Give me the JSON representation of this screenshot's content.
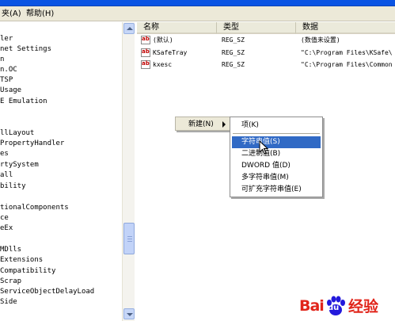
{
  "menubar": {
    "items": [
      "夹(A)",
      "帮助(H)"
    ]
  },
  "tree": {
    "items": [
      "ler",
      "net Settings",
      "n",
      "n.OC",
      "TSP",
      "Usage",
      "E Emulation",
      "",
      "",
      "llLayout",
      "PropertyHandler",
      "es",
      "rtySystem",
      "all",
      "bility",
      "",
      "tionalComponents",
      "ce",
      "eEx",
      "",
      "MDlls",
      "Extensions",
      "Compatibility",
      "Scrap",
      "ServiceObjectDelayLoad",
      "Side"
    ]
  },
  "list": {
    "headers": {
      "name": "名称",
      "type": "类型",
      "data": "数据"
    },
    "rows": [
      {
        "name": "(默认)",
        "type": "REG_SZ",
        "data": "(数值未设置)"
      },
      {
        "name": "KSafeTray",
        "type": "REG_SZ",
        "data": "\"C:\\Program Files\\KSafe\\"
      },
      {
        "name": "kxesc",
        "type": "REG_SZ",
        "data": "\"C:\\Program Files\\Common"
      }
    ],
    "icon_text": "ab"
  },
  "context_menu": {
    "new_label": "新建(N)",
    "items": [
      {
        "label": "项(K)",
        "highlighted": false
      },
      {
        "label": "字符串值(S)",
        "highlighted": true
      },
      {
        "label": "二进制值(B)",
        "highlighted": false
      },
      {
        "label": "DWORD 值(D)",
        "highlighted": false
      },
      {
        "label": "多字符串值(M)",
        "highlighted": false
      },
      {
        "label": "可扩充字符串值(E)",
        "highlighted": false
      }
    ]
  },
  "watermark": {
    "text_left": "Bai",
    "text_paw": "du",
    "text_right": "经验"
  },
  "colors": {
    "accent": "#316ac5",
    "menubar": "#ece9d8",
    "brand_red": "#e1251b"
  }
}
